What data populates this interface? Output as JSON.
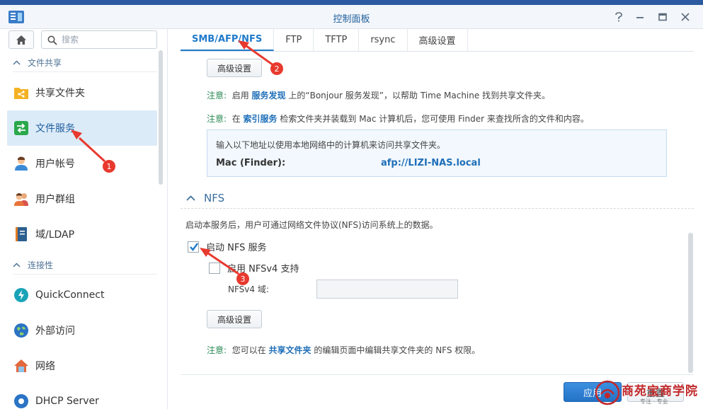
{
  "window": {
    "title": "控制面板",
    "controls": [
      "help-icon",
      "minimize-icon",
      "maximize-icon",
      "close-icon"
    ]
  },
  "sidebar": {
    "search_placeholder": "搜索",
    "sections": [
      {
        "label": "文件共享"
      },
      {
        "label": "连接性"
      }
    ],
    "items": [
      {
        "label": "共享文件夹",
        "icon": "shared-folder-icon"
      },
      {
        "label": "文件服务",
        "icon": "file-services-icon",
        "active": true
      },
      {
        "label": "用户帐号",
        "icon": "user-icon"
      },
      {
        "label": "用户群组",
        "icon": "group-icon"
      },
      {
        "label": "域/LDAP",
        "icon": "domain-ldap-icon"
      },
      {
        "label": "QuickConnect",
        "icon": "quickconnect-icon"
      },
      {
        "label": "外部访问",
        "icon": "external-access-icon"
      },
      {
        "label": "网络",
        "icon": "network-icon"
      },
      {
        "label": "DHCP Server",
        "icon": "dhcp-icon"
      }
    ]
  },
  "tabs": [
    {
      "label": "SMB/AFP/NFS",
      "active": true
    },
    {
      "label": "FTP"
    },
    {
      "label": "TFTP"
    },
    {
      "label": "rsync"
    },
    {
      "label": "高级设置"
    }
  ],
  "afp": {
    "advanced_button": "高级设置",
    "note1": {
      "label": "注意:",
      "pre": "启用",
      "link": "服务发现",
      "post": "上的“Bonjour 服务发现”，以帮助 Time Machine 找到共享文件夹。"
    },
    "note2": {
      "label": "注意:",
      "pre": "在",
      "link": "索引服务",
      "post": "检索文件夹并装载到 Mac 计算机后，您可使用 Finder 来查找所含的文件和内容。"
    },
    "info": {
      "line": "输入以下地址以使用本地网络中的计算机来访问共享文件夹。",
      "key": "Mac (Finder):",
      "value": "afp://LIZI-NAS.local"
    }
  },
  "nfs": {
    "section_title": "NFS",
    "description": "启动本服务后，用户可通过网络文件协议(NFS)访问系统上的数据。",
    "enable_label": "启动 NFS 服务",
    "enable_checked": true,
    "nfsv4_label": "启用 NFSv4 支持",
    "nfsv4_checked": false,
    "domain_label": "NFSv4 域:",
    "domain_value": "",
    "advanced_button": "高级设置",
    "note": {
      "label": "注意:",
      "pre": "您可以在",
      "link": "共享文件夹",
      "post": "的编辑页面中编辑共享文件夹的 NFS 权限。"
    }
  },
  "footer": {
    "apply": "应用",
    "reset": "重置"
  },
  "annotations": {
    "badges": [
      "1",
      "2",
      "3"
    ],
    "arrow_color": "#e8392e"
  },
  "watermark": {
    "text": "商苑宝商学院",
    "sub": "专注 · 专业"
  },
  "colors": {
    "accent": "#1f7acb",
    "active_bg": "#dcebf8",
    "note_green": "#2e8b57",
    "link": "#1f6fb8"
  }
}
